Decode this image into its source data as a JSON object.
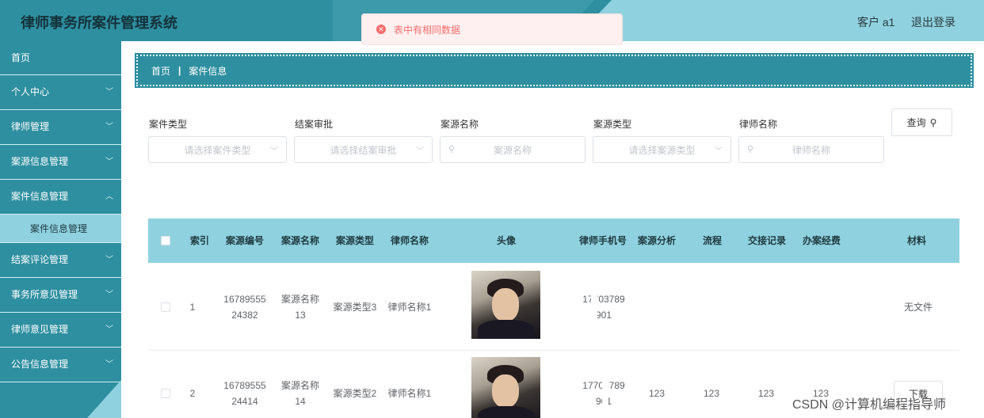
{
  "header": {
    "title": "律师事务所案件管理系统",
    "user_label": "客户 a1",
    "logout_label": "退出登录"
  },
  "toast": {
    "message": "表中有相同数据"
  },
  "sidebar": {
    "items": [
      {
        "label": "首页"
      },
      {
        "label": "个人中心"
      },
      {
        "label": "律师管理"
      },
      {
        "label": "案源信息管理"
      },
      {
        "label": "案件信息管理"
      },
      {
        "label": "结案评论管理"
      },
      {
        "label": "事务所意见管理"
      },
      {
        "label": "律师意见管理"
      },
      {
        "label": "公告信息管理"
      }
    ],
    "active_sub": "案件信息管理"
  },
  "breadcrumb": {
    "home": "首页",
    "current": "案件信息"
  },
  "filters": {
    "case_type": {
      "label": "案件类型",
      "placeholder": "请选择案件类型"
    },
    "closing_approval": {
      "label": "结案审批",
      "placeholder": "请选择结案审批"
    },
    "source_name": {
      "label": "案源名称",
      "placeholder": "案源名称"
    },
    "source_type": {
      "label": "案源类型",
      "placeholder": "请选择案源类型"
    },
    "lawyer_name": {
      "label": "律师名称",
      "placeholder": "律师名称"
    },
    "query_label": "查询"
  },
  "table": {
    "columns": [
      "索引",
      "案源编号",
      "案源名称",
      "案源类型",
      "律师名称",
      "头像",
      "律师手机号",
      "案源分析",
      "流程",
      "交接记录",
      "办案经费",
      "材料"
    ],
    "rows": [
      {
        "index": "1",
        "code": "1678955524382",
        "name": "案源名称13",
        "type": "案源类型3",
        "lawyer": "律师名称1",
        "phone": "17703789901",
        "analysis": "",
        "process": "",
        "handover": "",
        "funds": "",
        "material": "无文件"
      },
      {
        "index": "2",
        "code": "1678955524414",
        "name": "案源名称14",
        "type": "案源类型2",
        "lawyer": "律师名称1",
        "phone": "17703789901",
        "analysis": "123",
        "process": "123",
        "handover": "123",
        "funds": "123",
        "material": "下载"
      }
    ]
  },
  "watermark": "CSDN @计算机编程指导师",
  "colors": {
    "primary": "#2e8fa0",
    "light": "#8fd1df",
    "error": "#f56c6c"
  }
}
